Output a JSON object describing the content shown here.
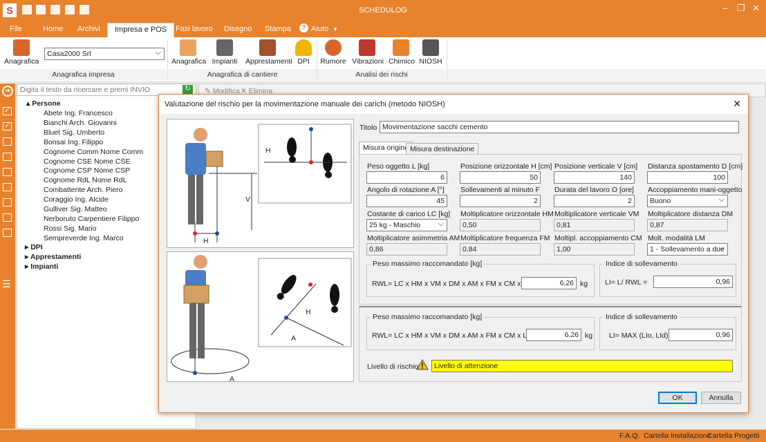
{
  "app": {
    "title": "SCHEDULOG"
  },
  "menu": {
    "file": "File",
    "home": "Home",
    "archivi": "Archivi",
    "impresa": "Impresa e POS",
    "fasi": "Fasi lavoro",
    "disegno": "Disegno",
    "stampa": "Stampa",
    "aiuto": "Aiuto"
  },
  "ribbon": {
    "anagrafica": "Anagrafica",
    "company": "Casa2000 Srl",
    "group_impresa": "Anagrafica impresa",
    "cantiere": [
      "Anagrafica",
      "Impianti",
      "Apprestamenti",
      "DPI"
    ],
    "group_cantiere": "Anagrafica di cantiere",
    "rischi": [
      "Rumore",
      "Vibrazioni",
      "Chimico",
      "NIOSH"
    ],
    "group_rischi": "Analisi dei rischi"
  },
  "left": {
    "search_placeholder": "Digita il testo da ricercare e premi INVIO",
    "persone": "Persone",
    "people": [
      "Abete Ing. Francesco",
      "Bianchi Arch. Giovanni",
      "Bluet Sig. Umberto",
      "Bonsai Ing. Filippo",
      "Cognome Comm Nome Comm",
      "Cognome CSE Nome CSE",
      "Cognome CSP Nome CSP",
      "Cognome RdL Nome RdL",
      "Combattente Arch. Piero",
      "Coraggio Ing. Alcide",
      "Gulliver Sig. Matteo",
      "Nerboruto Carpentiere Filippo",
      "Rossi Sig. Mario",
      "Sempreverde Ing. Marco"
    ],
    "dpi": "DPI",
    "apprestamenti": "Apprestamenti",
    "impianti": "Impianti"
  },
  "toolbar": {
    "modifica": "Modifica",
    "elimina": "Elimina"
  },
  "status": {
    "faq": "F.A.Q.",
    "install": "Cartella Installazione",
    "progetti": "Cartella Progetti"
  },
  "dialog": {
    "title": "Valutazione del rischio per la movimentazione manuale dei carichi (metodo NIOSH)",
    "titolo_label": "Titolo",
    "titolo_value": "Movimentazione sacchi cemento",
    "tab_origine": "Misura origine",
    "tab_destinazione": "Misura destinazione",
    "f_peso": "Peso oggetto  L [kg]",
    "v_peso": "6",
    "f_posH": "Posizione orizzontale H [cm]",
    "v_posH": "50",
    "f_posV": "Posizione verticale V [cm]",
    "v_posV": "140",
    "f_dist": "Distanza spostamento D [cm]",
    "v_dist": "100",
    "f_ang": "Angolo di rotazione A [°]",
    "v_ang": "45",
    "f_soll": "Sollevamenti al minuto F",
    "v_soll": "2",
    "f_dur": "Durata del lavoro O [ore]",
    "v_dur": "2",
    "f_acc": "Accoppiamento mani-oggetto",
    "v_acc": "Buono",
    "f_lc": "Costante di carico  LC [kg]",
    "v_lc": "25 kg - Maschio",
    "f_hm": "Moltiplicatore orizzontale HM",
    "v_hm": "0,50",
    "f_vm": "Moltiplicatore verticale VM",
    "v_vm": "0,81",
    "f_dm": "Moltiplicatore distanza DM",
    "v_dm": "0,87",
    "f_am": "Moltiplicatore asimmetria AM",
    "v_am": "0,86",
    "f_fm": "Moltiplicatore frequenza FM",
    "v_fm": "0,84",
    "f_cm": "Moltipl. accoppiamento CM",
    "v_cm": "1,00",
    "f_lm": "Molt. modalità LM",
    "v_lm": "1 - Sollevamento a due",
    "g_peso": "Peso massimo raccomandato [kg]",
    "rwl_formula": "RWL= LC x HM x VM x DM x AM x FM x CM x LM  =",
    "rwl_value": "6,26",
    "kg": "kg",
    "g_indice": "Indice di sollevamento",
    "li_formula": "LI= L/ RWL =",
    "li_value": "0,96",
    "rwl2_value": "6,26",
    "li2_formula": "LI= MAX (LIo, LId)",
    "li2_value": "0,96",
    "livello_label": "Livello di rischio",
    "livello_value": "Livello di attenzione",
    "ok": "OK",
    "annulla": "Annulla",
    "diagram": {
      "h": "H",
      "v": "V",
      "a": "A"
    }
  },
  "colors": {
    "accent": "#e8822c",
    "warning": "#ffff00"
  }
}
